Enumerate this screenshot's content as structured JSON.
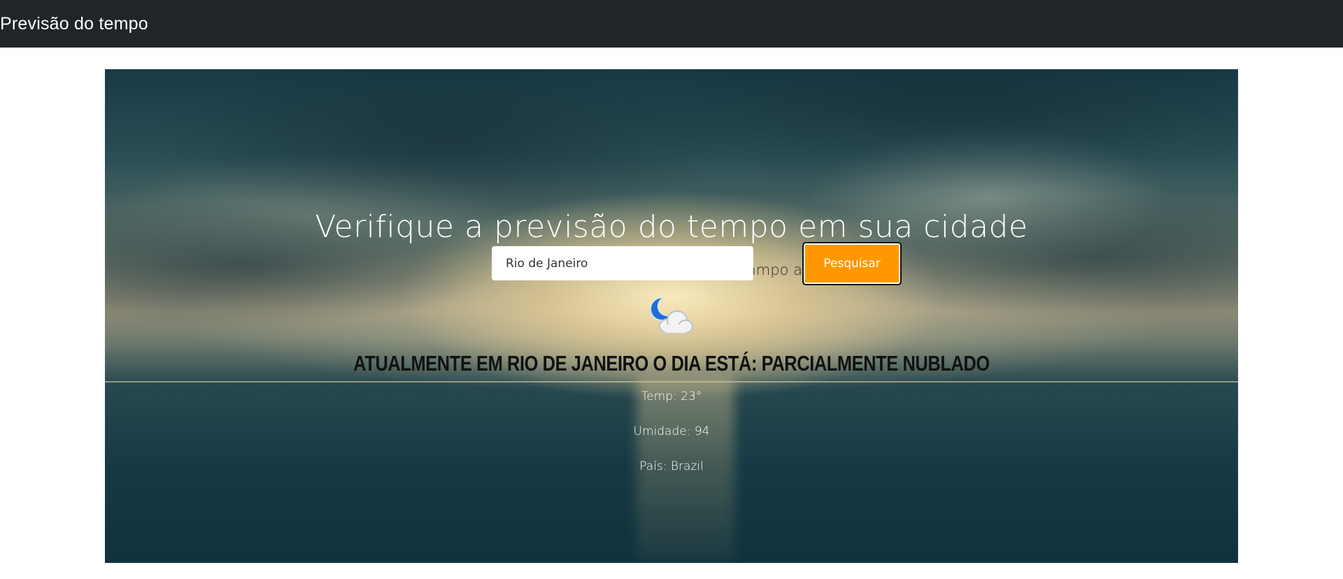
{
  "navbar": {
    "brand": "Previsão do tempo"
  },
  "hero": {
    "title": "Verifique a previsão do tempo em sua cidade",
    "subtitle": "Digite o nome da sua cidade no campo abaixo"
  },
  "search": {
    "value": "Rio de Janeiro",
    "button_label": "Pesquisar"
  },
  "weather": {
    "icon": "partly-cloudy-night-icon",
    "status": "Atualmente em Rio de Janeiro o dia está: parcialmente nublado",
    "temp": "Temp: 23°",
    "humidity": "Umidade: 94",
    "country": "País: Brazil"
  },
  "colors": {
    "navbar_bg": "#212529",
    "button_bg": "#ff9800"
  }
}
